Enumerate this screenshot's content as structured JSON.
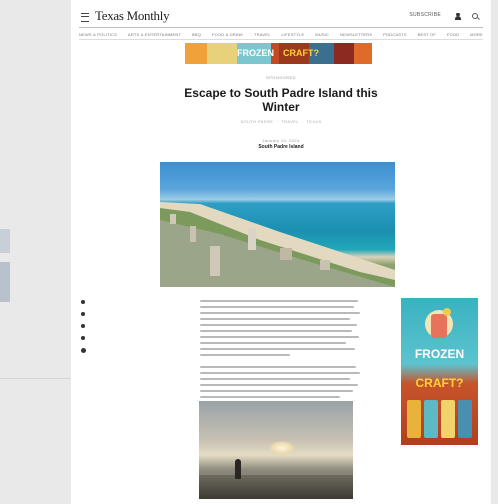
{
  "header": {
    "logo": "Texas Monthly",
    "subscribe_label": "SUBSCRIBE"
  },
  "nav": {
    "items": [
      "NEWS & POLITICS",
      "ARTS & ENTERTAINMENT",
      "BBQ",
      "FOOD & DRINK",
      "TRAVEL",
      "LIFESTYLE",
      "MUSIC",
      "NEWSLETTERS",
      "PODCASTS",
      "BEST OF",
      "FOOD",
      "MORE"
    ]
  },
  "ads": {
    "top_text_1": "FROZEN",
    "top_text_2": "CRAFT?",
    "side_text_1": "FROZEN",
    "side_text_2": "CRAFT?"
  },
  "article": {
    "kicker": "SPONSORED",
    "headline": "Escape to South Padre Island this Winter",
    "meta": [
      "SOUTH PADRE",
      "TRAVEL",
      "TEXAS"
    ],
    "dateline": "January 10, 2024",
    "author": "South Padre Island"
  },
  "colors": {
    "accent": "#1a1a1a",
    "ad_teal": "#39b2c0",
    "ad_orange": "#c7542a"
  }
}
